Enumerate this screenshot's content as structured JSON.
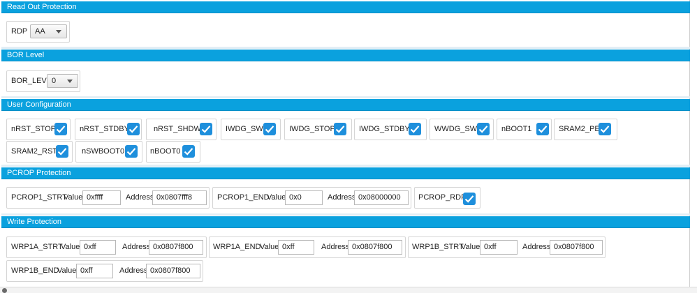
{
  "sections": {
    "rop": {
      "title": "Read Out Protection",
      "rdp_label": "RDP",
      "rdp_value": "AA"
    },
    "bor": {
      "title": "BOR Level",
      "bor_label": "BOR_LEV",
      "bor_value": "0"
    },
    "user": {
      "title": "User Configuration",
      "options": [
        {
          "label": "nRST_STOP",
          "checked": true
        },
        {
          "label": "nRST_STDBY",
          "checked": true
        },
        {
          "label": "nRST_SHDW",
          "checked": true
        },
        {
          "label": "IWDG_SW",
          "checked": true
        },
        {
          "label": "IWDG_STOP",
          "checked": true
        },
        {
          "label": "IWDG_STDBY",
          "checked": true
        },
        {
          "label": "WWDG_SW",
          "checked": true
        },
        {
          "label": "nBOOT1",
          "checked": true
        },
        {
          "label": "SRAM2_PE",
          "checked": true
        },
        {
          "label": "SRAM2_RST",
          "checked": true
        },
        {
          "label": "nSWBOOT0",
          "checked": true
        },
        {
          "label": "nBOOT0",
          "checked": true
        }
      ]
    },
    "pcrop": {
      "title": "PCROP Protection",
      "strt": {
        "label": "PCROP1_STRT",
        "value_label": "Value",
        "value": "0xffff",
        "address_label": "Address",
        "address": "0x0807fff8"
      },
      "end": {
        "label": "PCROP1_END",
        "value_label": "Value",
        "value": "0x0",
        "address_label": "Address",
        "address": "0x08000000"
      },
      "rdp": {
        "label": "PCROP_RDP",
        "checked": true
      }
    },
    "wrp": {
      "title": "Write Protection",
      "areas": [
        {
          "label": "WRP1A_STRT",
          "value_label": "Value",
          "value": "0xff",
          "address_label": "Address",
          "address": "0x0807f800"
        },
        {
          "label": "WRP1A_END",
          "value_label": "Value",
          "value": "0xff",
          "address_label": "Address",
          "address": "0x0807f800"
        },
        {
          "label": "WRP1B_STRT",
          "value_label": "Value",
          "value": "0xff",
          "address_label": "Address",
          "address": "0x0807f800"
        },
        {
          "label": "WRP1B_END",
          "value_label": "Value",
          "value": "0xff",
          "address_label": "Address",
          "address": "0x0807f800"
        }
      ]
    }
  },
  "colors": {
    "header": "#0aa1de",
    "checkbox": "#1e8fdc"
  },
  "icons": {
    "checkbox": "checkmark-icon",
    "dropdown": "chevron-down-icon"
  }
}
